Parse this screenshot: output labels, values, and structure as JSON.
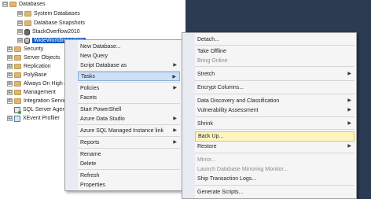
{
  "tree": {
    "items": [
      {
        "label": "Databases",
        "expander": "⊟"
      },
      {
        "label": "System Databases",
        "expander": "⊞"
      },
      {
        "label": "Database Snapshots",
        "expander": "⊞"
      },
      {
        "label": "StackOverflow2010",
        "expander": "⊞"
      },
      {
        "label": "WideWorldImporters",
        "expander": "⊞"
      },
      {
        "label": "Security",
        "expander": "⊞"
      },
      {
        "label": "Server Objects",
        "expander": "⊞"
      },
      {
        "label": "Replication",
        "expander": "⊞"
      },
      {
        "label": "PolyBase",
        "expander": "⊞"
      },
      {
        "label": "Always On High Availability",
        "expander": "⊞"
      },
      {
        "label": "Management",
        "expander": "⊞"
      },
      {
        "label": "Integration Services Catalogs",
        "expander": "⊞"
      },
      {
        "label": "SQL Server Agent",
        "expander": ""
      },
      {
        "label": "XEvent Profiler",
        "expander": "⊞"
      }
    ]
  },
  "context_menu": {
    "items": [
      "New Database...",
      "New Query",
      "Script Database as",
      "Tasks",
      "Policies",
      "Facets",
      "Start PowerShell",
      "Azure Data Studio",
      "Azure SQL Managed Instance link",
      "Reports",
      "Rename",
      "Delete",
      "Refresh",
      "Properties"
    ],
    "submenu_arrow": "▶"
  },
  "tasks_menu": {
    "items": [
      "Detach...",
      "Take Offline",
      "Bring Online",
      "Stretch",
      "Encrypt Columns...",
      "Data Discovery and Classification",
      "Vulnerability Assessment",
      "Shrink",
      "Back Up...",
      "Restore",
      "Mirror...",
      "Launch Database Mirroring Monitor...",
      "Ship Transaction Logs...",
      "Generate Scripts..."
    ],
    "submenu_arrow": "▶"
  }
}
